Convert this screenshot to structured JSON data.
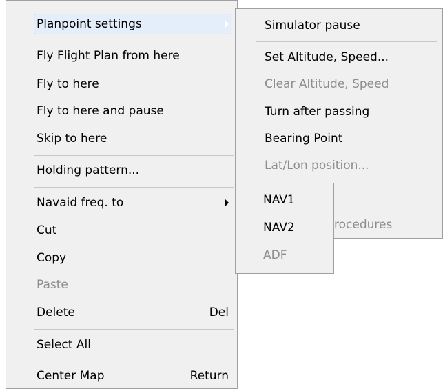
{
  "main_menu": {
    "planpoint_settings": "Planpoint settings",
    "fly_flight_plan": "Fly Flight Plan from here",
    "fly_to_here": "Fly to here",
    "fly_to_here_pause": "Fly to here and pause",
    "skip_to_here": "Skip to here",
    "holding_pattern": "Holding pattern...",
    "navaid_freq": "Navaid freq. to",
    "cut": "Cut",
    "copy": "Copy",
    "paste": "Paste",
    "delete": "Delete",
    "delete_shortcut": "Del",
    "select_all": "Select All",
    "center_map": "Center Map",
    "center_map_shortcut": "Return"
  },
  "submenu": {
    "simulator_pause": "Simulator pause",
    "set_alt_speed": "Set Altitude, Speed...",
    "clear_alt_speed": "Clear Altitude, Speed",
    "turn_after_passing": "Turn after passing",
    "bearing_point": "Bearing Point",
    "lat_lon_position": "Lat/Lon position...",
    "procedures_partial": "rocedures"
  },
  "navaid_menu": {
    "nav1": "NAV1",
    "nav2": "NAV2",
    "adf": "ADF"
  }
}
